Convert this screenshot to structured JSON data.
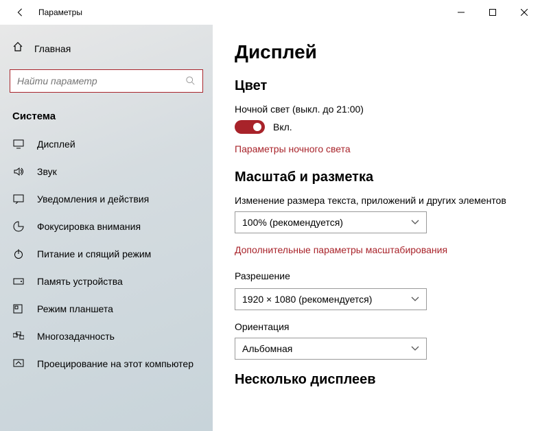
{
  "titlebar": {
    "title": "Параметры"
  },
  "sidebar": {
    "home": "Главная",
    "search_placeholder": "Найти параметр",
    "heading": "Система",
    "items": [
      {
        "label": "Дисплей"
      },
      {
        "label": "Звук"
      },
      {
        "label": "Уведомления и действия"
      },
      {
        "label": "Фокусировка внимания"
      },
      {
        "label": "Питание и спящий режим"
      },
      {
        "label": "Память устройства"
      },
      {
        "label": "Режим планшета"
      },
      {
        "label": "Многозадачность"
      },
      {
        "label": "Проецирование на этот компьютер"
      }
    ]
  },
  "content": {
    "page_title": "Дисплей",
    "color_heading": "Цвет",
    "night_light_label": "Ночной свет (выкл. до 21:00)",
    "toggle_on": "Вкл.",
    "night_light_link": "Параметры ночного света",
    "scale_heading": "Масштаб и разметка",
    "scale_label": "Изменение размера текста, приложений и других элементов",
    "scale_value": "100% (рекомендуется)",
    "scale_link": "Дополнительные параметры масштабирования",
    "resolution_label": "Разрешение",
    "resolution_value": "1920 × 1080 (рекомендуется)",
    "orientation_label": "Ориентация",
    "orientation_value": "Альбомная",
    "multi_heading": "Несколько дисплеев"
  }
}
